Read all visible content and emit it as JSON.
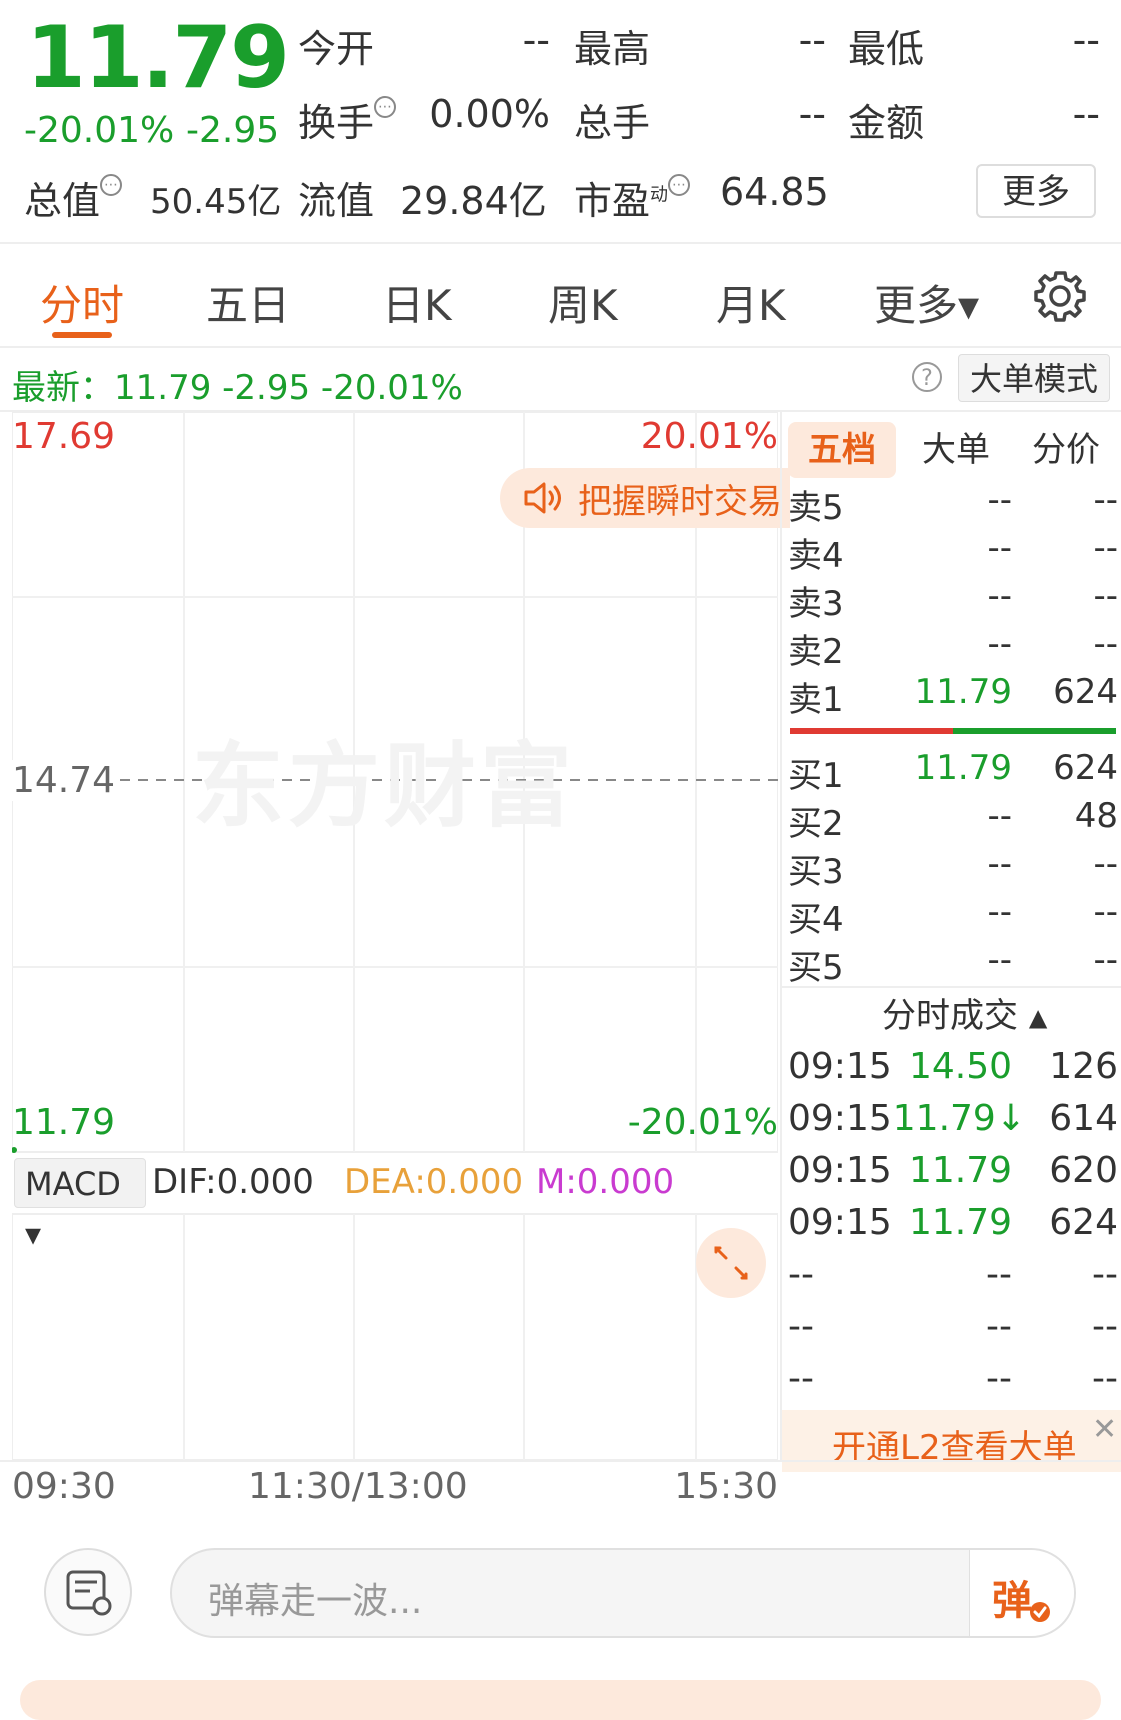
{
  "quote": {
    "price": "11.79",
    "change_pct": "-20.01%",
    "change_abs": "-2.95",
    "fields": {
      "open_label": "今开",
      "open_value": "--",
      "high_label": "最高",
      "high_value": "--",
      "low_label": "最低",
      "low_value": "--",
      "turnover_label": "换手",
      "turnover_value": "0.00%",
      "volume_label": "总手",
      "volume_value": "--",
      "amount_label": "金额",
      "amount_value": "--",
      "mktcap_label": "总值",
      "mktcap_value": "50.45亿",
      "float_label": "流值",
      "float_value": "29.84亿",
      "pe_label": "市盈",
      "pe_sup": "动",
      "pe_value": "64.85"
    },
    "more_button": "更多"
  },
  "tabs": {
    "items": [
      "分时",
      "五日",
      "日K",
      "周K",
      "月K",
      "更多▾"
    ],
    "active_index": 0
  },
  "latest": {
    "text": "最新：11.79  -2.95  -20.01%",
    "help": "?",
    "big_order_mode": "大单模式"
  },
  "chart": {
    "top_price": "17.69",
    "top_pct": "20.01%",
    "mid_price": "14.74",
    "bottom_price": "11.79",
    "bottom_pct": "-20.01%",
    "watermark": "东方财富",
    "promo_pill": "把握瞬时交易",
    "macd": {
      "selector": "MACD ▾",
      "dif": "DIF:0.000",
      "dea": "DEA:0.000",
      "m": "M:0.000",
      "dea_color": "#e8a13a",
      "m_color": "#c93bd0"
    },
    "time_labels": [
      "09:30",
      "11:30/13:00",
      "15:30"
    ]
  },
  "order_book": {
    "tabs": [
      "五档",
      "大单",
      "分价"
    ],
    "active_tab": 0,
    "asks": [
      {
        "label": "卖5",
        "price": "--",
        "vol": "--"
      },
      {
        "label": "卖4",
        "price": "--",
        "vol": "--"
      },
      {
        "label": "卖3",
        "price": "--",
        "vol": "--"
      },
      {
        "label": "卖2",
        "price": "--",
        "vol": "--"
      },
      {
        "label": "卖1",
        "price": "11.79",
        "vol": "624"
      }
    ],
    "bids": [
      {
        "label": "买1",
        "price": "11.79",
        "vol": "624"
      },
      {
        "label": "买2",
        "price": "--",
        "vol": "48"
      },
      {
        "label": "买3",
        "price": "--",
        "vol": "--"
      },
      {
        "label": "买4",
        "price": "--",
        "vol": "--"
      },
      {
        "label": "买5",
        "price": "--",
        "vol": "--"
      }
    ],
    "trades_title": "分时成交",
    "trades": [
      {
        "time": "09:15",
        "price": "14.50",
        "vol": "126"
      },
      {
        "time": "09:15",
        "price": "11.79↓",
        "vol": "614"
      },
      {
        "time": "09:15",
        "price": "11.79",
        "vol": "620"
      },
      {
        "time": "09:15",
        "price": "11.79",
        "vol": "624"
      },
      {
        "time": "--",
        "price": "--",
        "vol": "--"
      },
      {
        "time": "--",
        "price": "--",
        "vol": "--"
      },
      {
        "time": "--",
        "price": "--",
        "vol": "--"
      },
      {
        "time": "--",
        "price": "--",
        "vol": "--"
      }
    ],
    "l2_banner": "开通L2查看大单",
    "l2_close": "✕"
  },
  "bottom": {
    "danmu_placeholder": "弹幕走一波...",
    "danmu_send": "弹"
  },
  "colors": {
    "down": "#1a9e2c",
    "up": "#e03a32",
    "accent": "#e8611a"
  },
  "icons": {
    "settings": "gear-icon",
    "sound": "speaker-icon",
    "expand": "expand-icon",
    "notes": "notes-icon",
    "help": "help-icon",
    "close": "close-icon"
  }
}
